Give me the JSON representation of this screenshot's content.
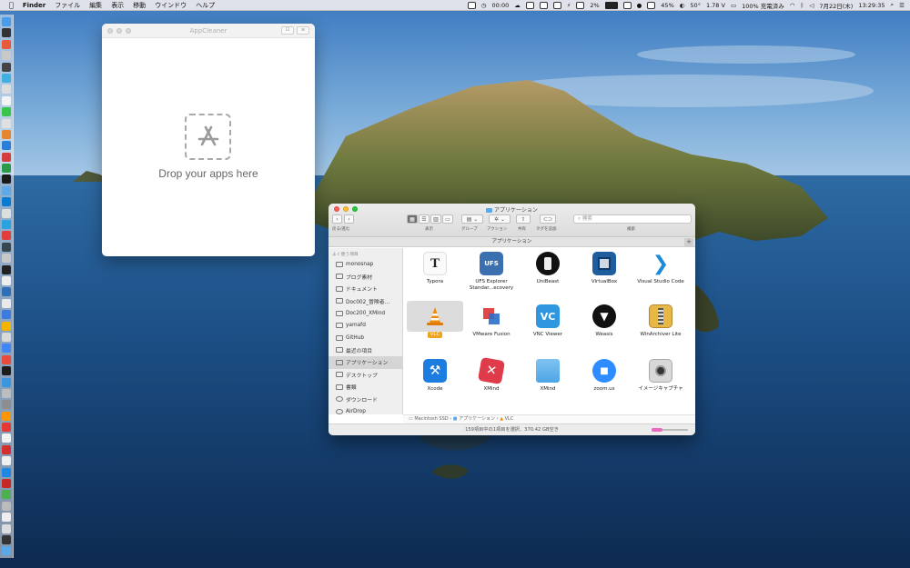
{
  "menubar": {
    "apple": "",
    "app_name": "Finder",
    "menus": [
      "ファイル",
      "編集",
      "表示",
      "移動",
      "ウインドウ",
      "ヘルプ"
    ],
    "status": {
      "timer": "00:00",
      "battery_pct": "2%",
      "cpu": "45%",
      "temp": "50°",
      "voltage": "1.78 V",
      "charge": "100% 充電済み",
      "date": "7月22日(木)",
      "time": "13:29:35"
    }
  },
  "appcleaner": {
    "title": "AppCleaner",
    "drop_text": "Drop your apps here"
  },
  "finder": {
    "title": "アプリケーション",
    "toolbar": {
      "back_forward": "戻る/進む",
      "view": "表示",
      "group": "グループ",
      "action": "アクション",
      "share": "共有",
      "tags": "タグを追加",
      "search_placeholder": "検索",
      "search_label": "検索"
    },
    "path_header": "アプリケーション",
    "sidebar": {
      "heading": "よく使う項目",
      "items": [
        "monosnap",
        "ブログ素材",
        "ドキュメント",
        "Doc002_冒険者…",
        "Doc200_XMind",
        "yamafd",
        "GitHub",
        "最近の項目",
        "アプリケーション",
        "デスクトップ",
        "書類",
        "ダウンロード",
        "AirDrop"
      ]
    },
    "apps": [
      {
        "name": "Typora",
        "icon": "typora-icon",
        "glyph": "T"
      },
      {
        "name": "UFS Explorer Standar...ecovery",
        "icon": "ufs-explorer-icon",
        "glyph": "UFS"
      },
      {
        "name": "UniBeast",
        "icon": "unibeast-icon",
        "glyph": ""
      },
      {
        "name": "VirtualBox",
        "icon": "virtualbox-icon",
        "glyph": ""
      },
      {
        "name": "Visual Studio Code",
        "icon": "vscode-icon",
        "glyph": "❯"
      },
      {
        "name": "VLC",
        "icon": "vlc-icon",
        "glyph": ""
      },
      {
        "name": "VMware Fusion",
        "icon": "vmware-fusion-icon",
        "glyph": ""
      },
      {
        "name": "VNC Viewer",
        "icon": "vnc-viewer-icon",
        "glyph": "VC"
      },
      {
        "name": "Weasis",
        "icon": "weasis-icon",
        "glyph": "▼"
      },
      {
        "name": "WinArchiver Lite",
        "icon": "winarchiver-icon",
        "glyph": ""
      },
      {
        "name": "Xcode",
        "icon": "xcode-icon",
        "glyph": "⚒"
      },
      {
        "name": "XMind",
        "icon": "xmind-icon",
        "glyph": "✕"
      },
      {
        "name": "XMind",
        "icon": "folder-icon",
        "glyph": ""
      },
      {
        "name": "zoom.us",
        "icon": "zoom-icon",
        "glyph": "■"
      },
      {
        "name": "イメージキャプチャ",
        "icon": "image-capture-icon",
        "glyph": ""
      }
    ],
    "selected_app_index": 5,
    "path_bar": [
      "Macintosh SSD",
      "アプリケーション",
      "VLC"
    ],
    "status": "159項目中の1項目を選択、370.42 GB空き"
  }
}
